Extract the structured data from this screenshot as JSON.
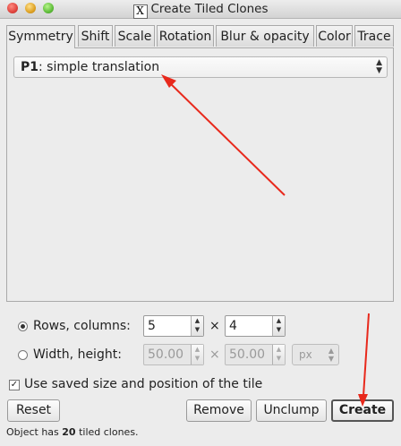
{
  "window": {
    "title": "Create Tiled Clones",
    "app_icon": "X"
  },
  "tabs": [
    {
      "label": "Symmetry",
      "active": true
    },
    {
      "label": "Shift"
    },
    {
      "label": "Scale"
    },
    {
      "label": "Rotation"
    },
    {
      "label": "Blur & opacity"
    },
    {
      "label": "Color"
    },
    {
      "label": "Trace"
    }
  ],
  "symmetry": {
    "group_code": "P1",
    "group_rest": ": simple translation"
  },
  "rows_columns": {
    "label": "Rows, columns:",
    "rows": "5",
    "times": "×",
    "columns": "4",
    "selected": true
  },
  "width_height": {
    "label": "Width, height:",
    "width": "50.00",
    "times": "×",
    "height": "50.00",
    "unit": "px",
    "selected": false
  },
  "use_saved": {
    "label": "Use saved size and position of the tile",
    "checked": true
  },
  "buttons": {
    "reset": "Reset",
    "remove": "Remove",
    "unclump": "Unclump",
    "create": "Create"
  },
  "status": {
    "prefix": "Object has ",
    "count": "20",
    "suffix": " tiled clones."
  },
  "annotation_color": "#e8291c"
}
